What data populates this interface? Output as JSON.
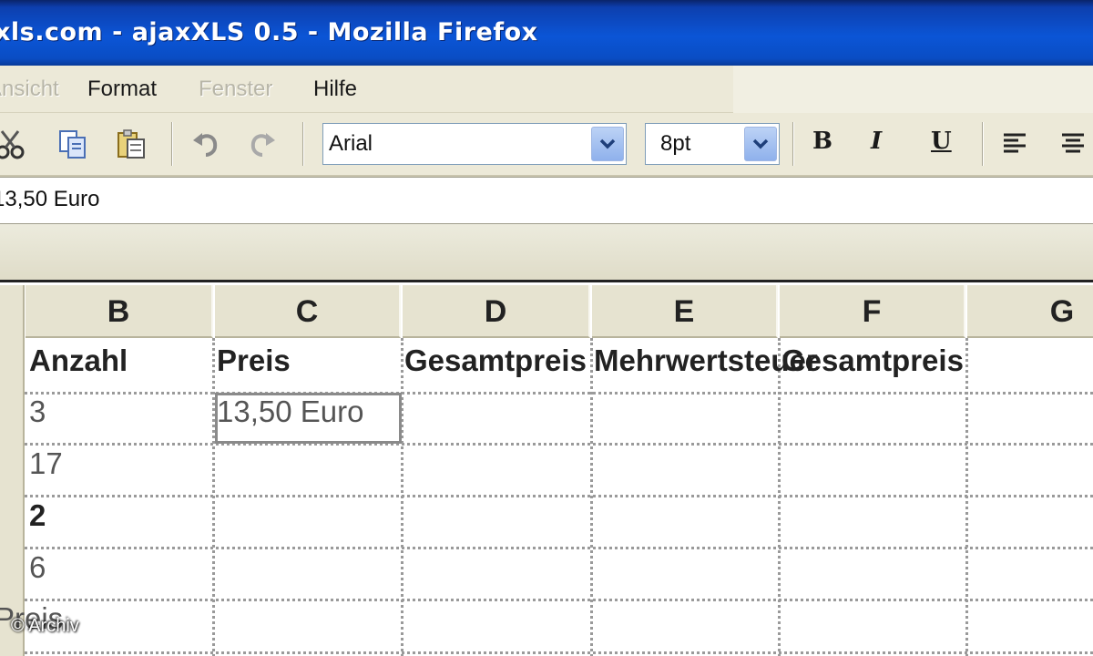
{
  "window": {
    "title": "xls.com - ajaxXLS 0.5 - Mozilla Firefox"
  },
  "menubar": {
    "items": [
      {
        "label": "Ansicht",
        "enabled": false
      },
      {
        "label": "Format",
        "enabled": true
      },
      {
        "label": "Fenster",
        "enabled": false
      },
      {
        "label": "Hilfe",
        "enabled": true
      }
    ]
  },
  "toolbar": {
    "icons": [
      "cut-icon",
      "copy-icon",
      "paste-icon",
      "undo-icon",
      "redo-icon"
    ],
    "font": {
      "value": "Arial"
    },
    "size": {
      "value": "8pt"
    },
    "format_buttons": {
      "bold": "B",
      "italic": "I",
      "underline": "U"
    }
  },
  "formula": {
    "value": "13,50 Euro"
  },
  "grid": {
    "columns": [
      "B",
      "C",
      "D",
      "E",
      "F",
      "G"
    ],
    "rows": [
      [
        "Anzahl",
        "Preis",
        "Gesamtpreis",
        "Mehrwertsteuer",
        "Gesamtpreis",
        ""
      ],
      [
        "3",
        "13,50 Euro",
        "",
        "",
        "",
        ""
      ],
      [
        "17",
        "",
        "",
        "",
        "",
        ""
      ],
      [
        "2",
        "",
        "",
        "",
        "",
        ""
      ],
      [
        "6",
        "",
        "",
        "",
        "",
        ""
      ],
      [
        "",
        "",
        "",
        "",
        "",
        ""
      ]
    ],
    "partial_left_label": "Preis",
    "selected_cell": "C2"
  },
  "watermark": "© Archiv",
  "colors": {
    "titlebar": "#0b55d6",
    "chrome": "#ece9d8",
    "dropdown_accent": "#8fb1ec"
  }
}
